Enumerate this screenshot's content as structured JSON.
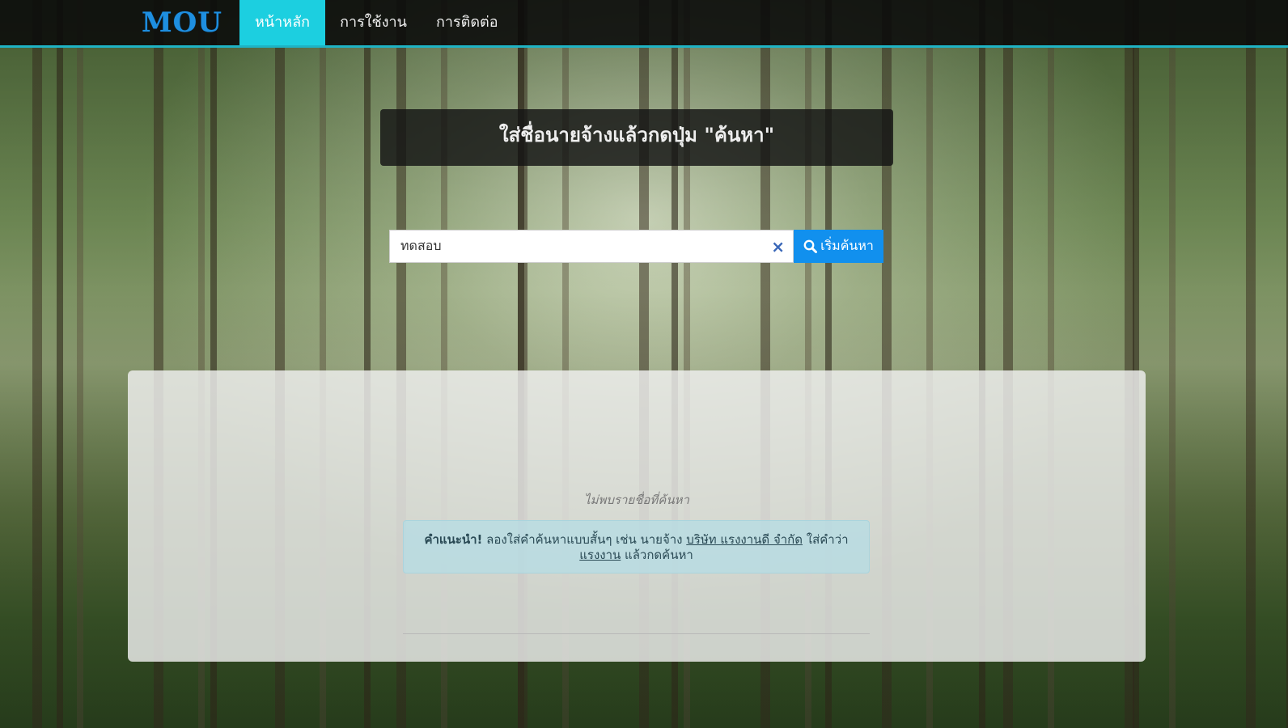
{
  "navbar": {
    "brand": "MOU",
    "items": [
      {
        "label": "หน้าหลัก",
        "active": true
      },
      {
        "label": "การใช้งาน",
        "active": false
      },
      {
        "label": "การติดต่อ",
        "active": false
      }
    ]
  },
  "header": {
    "title": "ใส่ชื่อนายจ้างแล้วกดปุ่ม \"ค้นหา\""
  },
  "search": {
    "value": "ทดสอบ",
    "clear_icon": "×",
    "button_label": "เริ่มค้นหา"
  },
  "results": {
    "empty_message": "ไม่พบรายชื่อที่ค้นหา",
    "tip": {
      "strong": "คำแนะนำ!",
      "text_1": " ลองใส่คำค้นหาแบบสั้นๆ เช่น นายจ้าง ",
      "link_1": "บริษัท แรงงานดี จำกัด",
      "text_2": " ใส่คำว่า ",
      "link_2": "แรงงาน",
      "text_3": " แล้วกดค้นหา"
    }
  },
  "colors": {
    "accent": "#1ccfe0",
    "brand": "#1e8fe0",
    "button": "#1190ee"
  }
}
